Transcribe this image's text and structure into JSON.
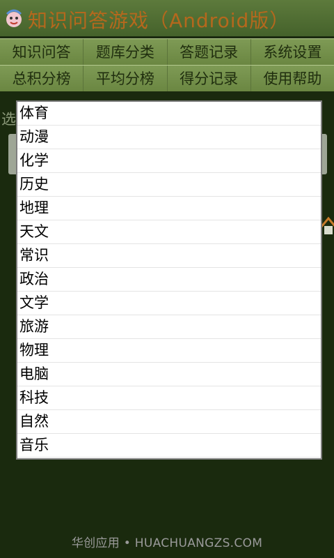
{
  "app": {
    "title": "知识问答游戏（Android版）"
  },
  "menu": {
    "row1": [
      "知识问答",
      "题库分类",
      "答题记录",
      "系统设置"
    ],
    "row2": [
      "总积分榜",
      "平均分榜",
      "得分记录",
      "使用帮助"
    ]
  },
  "background": {
    "label": "选"
  },
  "category_list": {
    "items": [
      "体育",
      "动漫",
      "化学",
      "历史",
      "地理",
      "天文",
      "常识",
      "政治",
      "文学",
      "旅游",
      "物理",
      "电脑",
      "科技",
      "自然",
      "音乐"
    ]
  },
  "footer": {
    "text": "华创应用 • HUACHUANGZS.COM"
  },
  "colors": {
    "title": "#b5681d",
    "menu_bg": "#7e9a55",
    "dialog_bg": "#ffffff"
  }
}
